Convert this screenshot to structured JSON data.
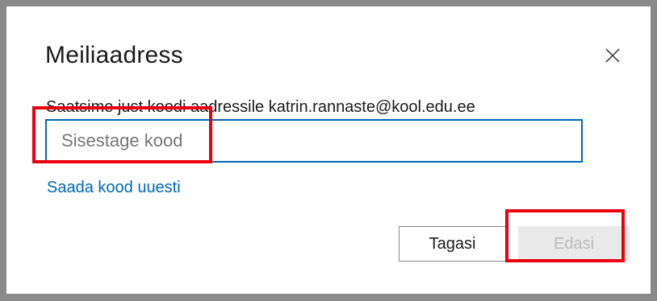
{
  "dialog": {
    "title": "Meiliaadress",
    "close_icon": "close-icon",
    "info_text": "Saatsime just koodi aadressile katrin.rannaste@kool.edu.ee",
    "code_input": {
      "value": "",
      "placeholder": "Sisestage kood"
    },
    "resend_link": "Saada kood uuesti",
    "buttons": {
      "back": "Tagasi",
      "next": "Edasi",
      "next_disabled": true
    }
  },
  "colors": {
    "accent": "#0067b8",
    "annotation": "#e8000e",
    "disabled_bg": "#e9e9e9",
    "disabled_text": "#bcbcbc"
  }
}
